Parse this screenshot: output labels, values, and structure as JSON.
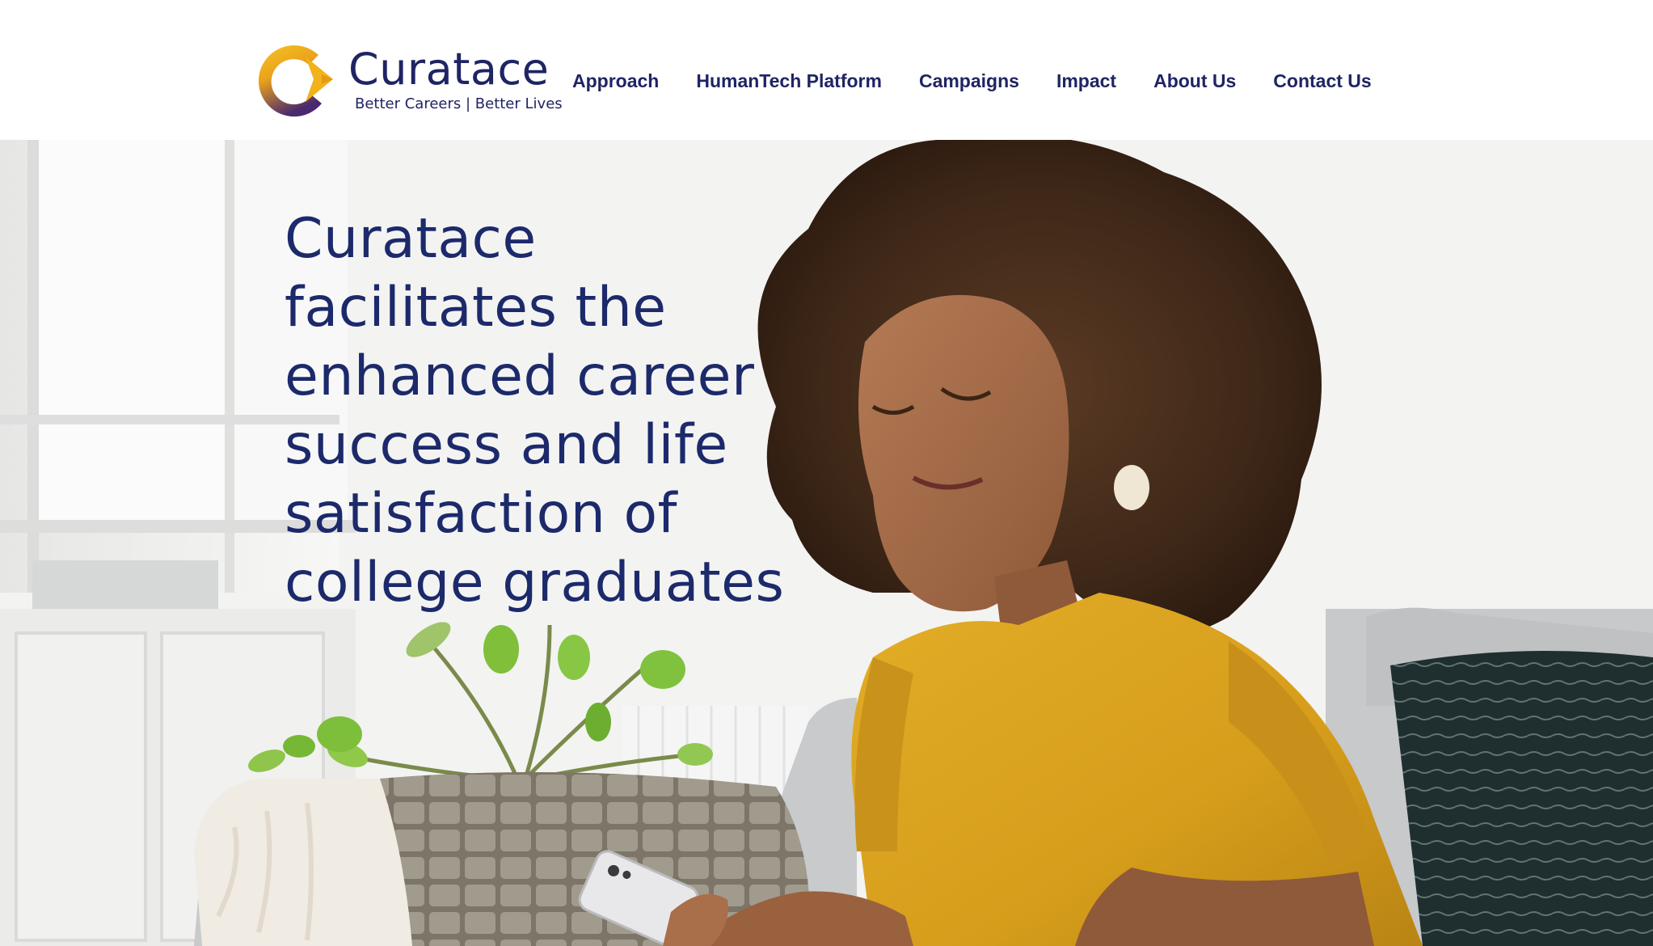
{
  "brand": {
    "name": "Curatace",
    "tagline": "Better Careers | Better Lives",
    "colors": {
      "navy": "#1f2463",
      "gold": "#f2b21c",
      "purple": "#4a2a6e"
    }
  },
  "nav": {
    "items": [
      {
        "label": "Approach"
      },
      {
        "label": "HumanTech Platform"
      },
      {
        "label": "Campaigns"
      },
      {
        "label": "Impact"
      },
      {
        "label": "About Us"
      },
      {
        "label": "Contact Us"
      }
    ]
  },
  "hero": {
    "heading": "Curatace facilitates the enhanced career success and life satisfaction of college graduates",
    "colors": {
      "heading": "#1c2a6b",
      "shirt": "#d9a21e",
      "sofa": "#c9cbcc",
      "pillar_pillow": "#1f2e2f"
    }
  }
}
